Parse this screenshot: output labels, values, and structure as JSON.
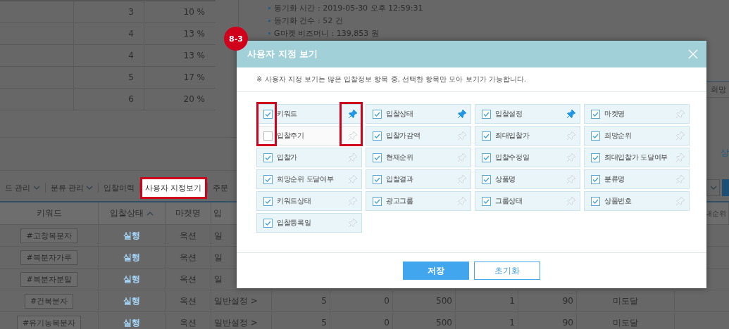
{
  "summary_table": {
    "rows": [
      {
        "count": "3",
        "share": "10 %"
      },
      {
        "count": "4",
        "share": "13 %"
      },
      {
        "count": "4",
        "share": "13 %"
      },
      {
        "count": "5",
        "share": "17 %"
      },
      {
        "count": "6",
        "share": "20 %"
      }
    ]
  },
  "sync_info": [
    "동기화 시간 : 2019-05-30 오후 12:59:31",
    "동기화 건수 : 52 건",
    "G마켓 비즈머니 : 139,853 원"
  ],
  "side_header": "희망",
  "side_link": "상",
  "toolbar": {
    "items": [
      {
        "label": "드 관리",
        "kind": "dropdown",
        "selected": false
      },
      {
        "label": "분류 관리",
        "kind": "dropdown",
        "selected": false
      },
      {
        "label": "입찰이력",
        "kind": "link",
        "selected": false
      },
      {
        "label": "사용자 지정보기",
        "kind": "link",
        "selected": true
      },
      {
        "label": "주문",
        "kind": "link",
        "selected": false
      }
    ]
  },
  "table": {
    "columns": [
      {
        "label": "키워드",
        "sorted": false
      },
      {
        "label": "입찰상태",
        "sorted": true
      },
      {
        "label": "마켓명",
        "sorted": false
      },
      {
        "label": "입",
        "sorted": false
      },
      {
        "label": "내순위",
        "sorted": false
      }
    ],
    "rows": [
      {
        "keyword": "#고창복분자",
        "status": "실행",
        "market": "옥션",
        "setting": "일"
      },
      {
        "keyword": "#복분자가루",
        "status": "실행",
        "market": "옥션",
        "setting": "일"
      },
      {
        "keyword": "#복분자분말",
        "status": "실행",
        "market": "옥션",
        "setting": "일"
      },
      {
        "keyword": "#건복분자",
        "status": "실행",
        "market": "옥션",
        "setting": "일반설정 >",
        "values": [
          "5",
          "0",
          "500",
          "1",
          "90",
          "미도달"
        ]
      },
      {
        "keyword": "#유기농복분자",
        "status": "실행",
        "market": "옥션",
        "setting": "일반설정 >",
        "values": [
          "5",
          "0",
          "500",
          "1",
          "90",
          "미도달"
        ]
      }
    ]
  },
  "step_badge": "8-3",
  "dialog": {
    "title": "사용자 지정 보기",
    "notice": "※ 사용자 지정 보기는 많은 입찰정보 항목 중, 선택한 항목만 모아 보기가 가능합니다.",
    "items": [
      {
        "label": "키워드",
        "checked": true,
        "pinned": true
      },
      {
        "label": "입찰상태",
        "checked": true,
        "pinned": true
      },
      {
        "label": "입찰설정",
        "checked": true,
        "pinned": true
      },
      {
        "label": "마켓명",
        "checked": true,
        "pinned": false
      },
      {
        "label": "입찰주기",
        "checked": false,
        "pinned": false
      },
      {
        "label": "입찰가감액",
        "checked": true,
        "pinned": false
      },
      {
        "label": "최대입찰가",
        "checked": true,
        "pinned": false
      },
      {
        "label": "희망순위",
        "checked": true,
        "pinned": false
      },
      {
        "label": "입찰가",
        "checked": true,
        "pinned": false
      },
      {
        "label": "현재순위",
        "checked": true,
        "pinned": false
      },
      {
        "label": "입찰수정일",
        "checked": true,
        "pinned": false
      },
      {
        "label": "최대입찰가 도달여부",
        "checked": true,
        "pinned": false
      },
      {
        "label": "희망순위 도달여부",
        "checked": true,
        "pinned": false
      },
      {
        "label": "입찰결과",
        "checked": true,
        "pinned": false
      },
      {
        "label": "상품명",
        "checked": true,
        "pinned": false
      },
      {
        "label": "분류명",
        "checked": true,
        "pinned": false
      },
      {
        "label": "키워드상태",
        "checked": true,
        "pinned": false
      },
      {
        "label": "광고그룹",
        "checked": true,
        "pinned": false
      },
      {
        "label": "그룹상태",
        "checked": true,
        "pinned": false
      },
      {
        "label": "상품번호",
        "checked": true,
        "pinned": false
      },
      {
        "label": "입찰등록일",
        "checked": true,
        "pinned": false
      }
    ],
    "buttons": [
      {
        "label": "저장",
        "kind": "primary"
      },
      {
        "label": "초기화",
        "kind": "secondary"
      }
    ]
  }
}
